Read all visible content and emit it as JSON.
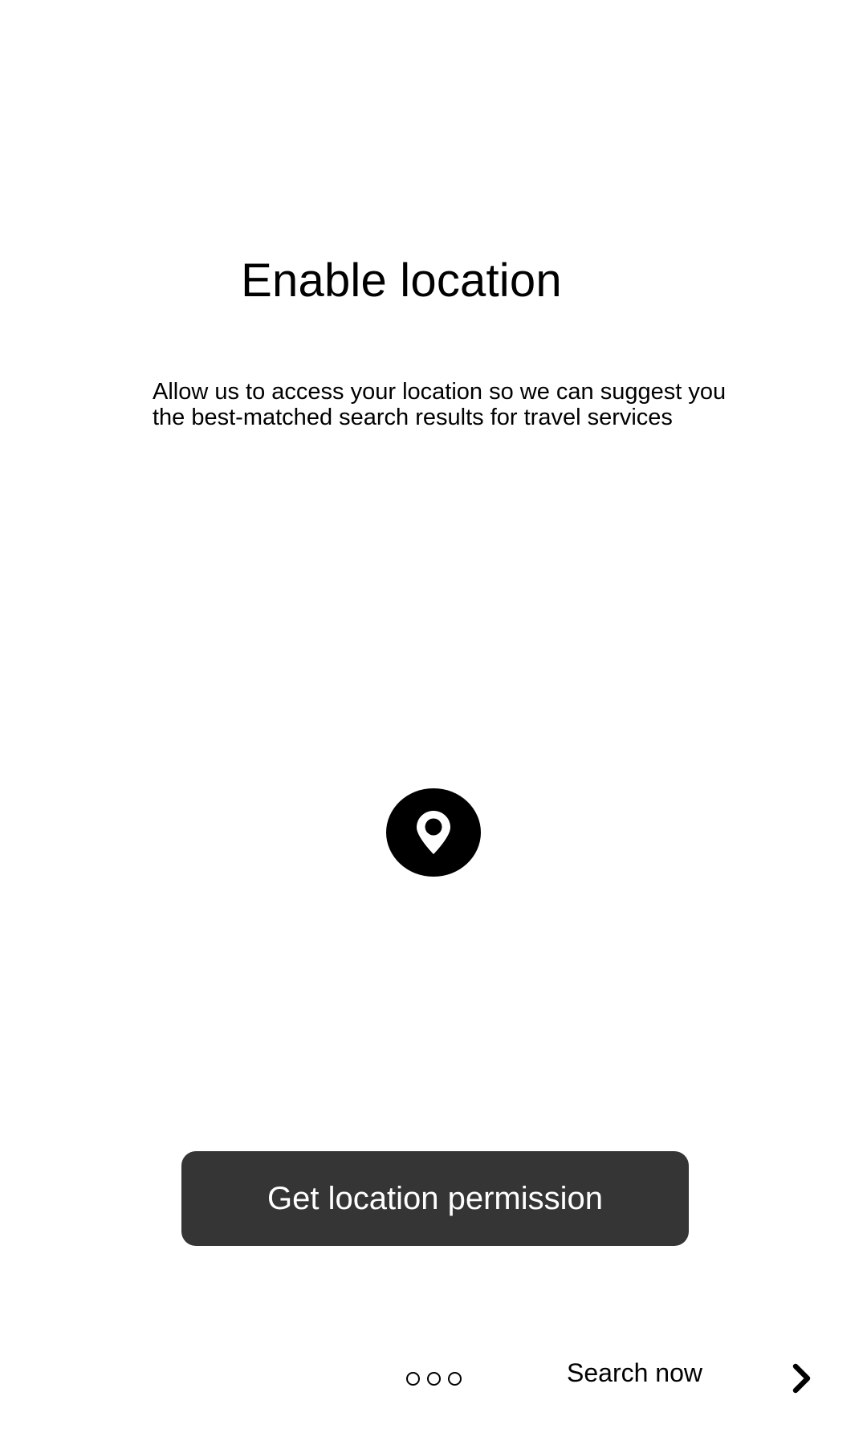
{
  "screen": {
    "title": "Enable location",
    "description": "Allow us to access your location so we can suggest you the best-matched search results for travel services"
  },
  "illustration": {
    "icon": "location-pin-icon"
  },
  "actions": {
    "primary_label": "Get location permission"
  },
  "footer": {
    "pager_dots": 3,
    "search_now_label": "Search now",
    "next_icon": "chevron-right-icon"
  },
  "colors": {
    "background": "#ffffff",
    "text": "#000000",
    "button_background": "#353535",
    "button_text": "#ffffff"
  }
}
